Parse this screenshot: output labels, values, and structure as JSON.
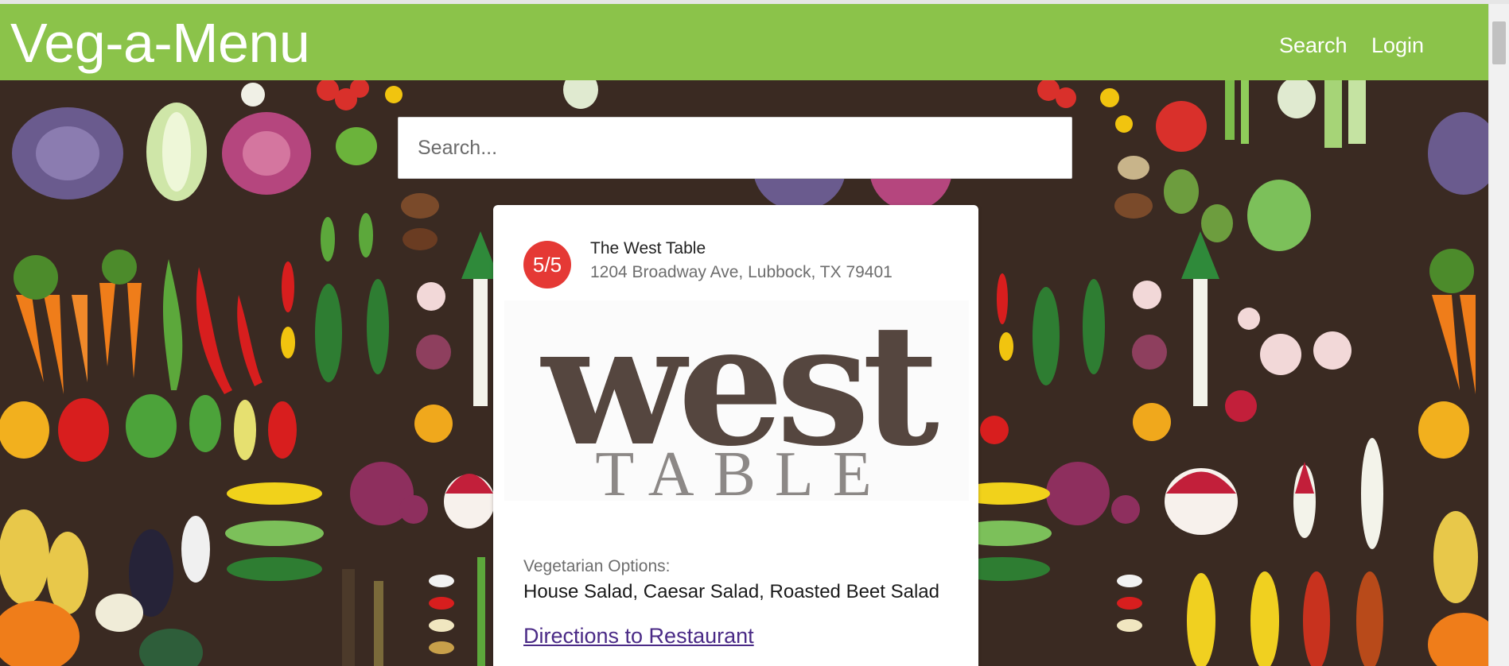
{
  "nav": {
    "brand": "Veg-a-Menu",
    "links": [
      "Search",
      "Login"
    ]
  },
  "search": {
    "placeholder": "Search..."
  },
  "restaurant": {
    "rating": "5/5",
    "name": "The West Table",
    "address": "1204 Broadway Ave, Lubbock, TX 79401",
    "logo_text": "west",
    "logo_subtext": "TABLE",
    "vegetarian_label": "Vegetarian Options:",
    "vegetarian_items": "House Salad, Caesar Salad, Roasted Beet Salad",
    "directions_label": "Directions to Restaurant"
  },
  "colors": {
    "navbar": "#8bc34a",
    "rating_badge": "#e53935",
    "hero_background": "#3a2a22",
    "link": "#4a2a86"
  },
  "icons": {
    "background": "vegetable-pattern"
  }
}
